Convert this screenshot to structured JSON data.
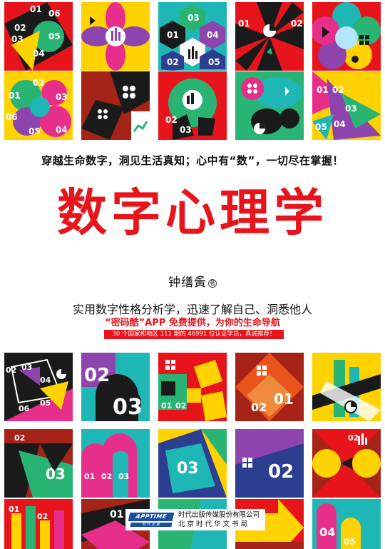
{
  "tagline": "穿越生命数字，洞见生活真知；心中有“数”，一切尽在掌握！",
  "title": "数字心理学",
  "author": {
    "name": "钟缮夤",
    "mark": "著"
  },
  "subtitle": "实用数字性格分析学，迅速了解自己、洞悉他人",
  "promo": "“密码酷”APP 免费提供，为你的生命导航",
  "stat_banner": "30 个国家和地区 111 期的 46991 位认证学员，真诚推荐！",
  "publisher": {
    "logo_top": "APPTIME",
    "logo_bottom": "时 代 出 版",
    "line1": "时代出版传媒股份有限公司",
    "line2": "北 京 时 代 华 文 书 局"
  },
  "tile_numbers": {
    "t1": [
      "01",
      "06",
      "02",
      "03",
      "05",
      "04"
    ],
    "t3": [
      "03",
      "01",
      "04",
      "02",
      "05"
    ],
    "t5": [
      "01",
      "02"
    ],
    "t6": [
      "02",
      "01",
      "03",
      "06",
      "05",
      "04"
    ],
    "t10": [
      "01",
      "02",
      "03",
      "05",
      "04"
    ],
    "t11": [
      "03",
      "02",
      "04",
      "06",
      "05"
    ],
    "t12": [
      "02",
      "03"
    ],
    "t13": [
      "01",
      "02"
    ],
    "t14": [
      "02",
      "01"
    ],
    "t16": [
      "02",
      "03"
    ],
    "t17": [
      "01",
      "02",
      "03"
    ],
    "t18": [
      "03"
    ],
    "t19": [
      "02"
    ],
    "t20": [
      "02"
    ],
    "t21": [
      "01",
      "02"
    ],
    "t22": [
      "01"
    ],
    "t23": [
      "03"
    ],
    "t24": [
      "02"
    ],
    "t25": [
      "04",
      "05"
    ]
  }
}
